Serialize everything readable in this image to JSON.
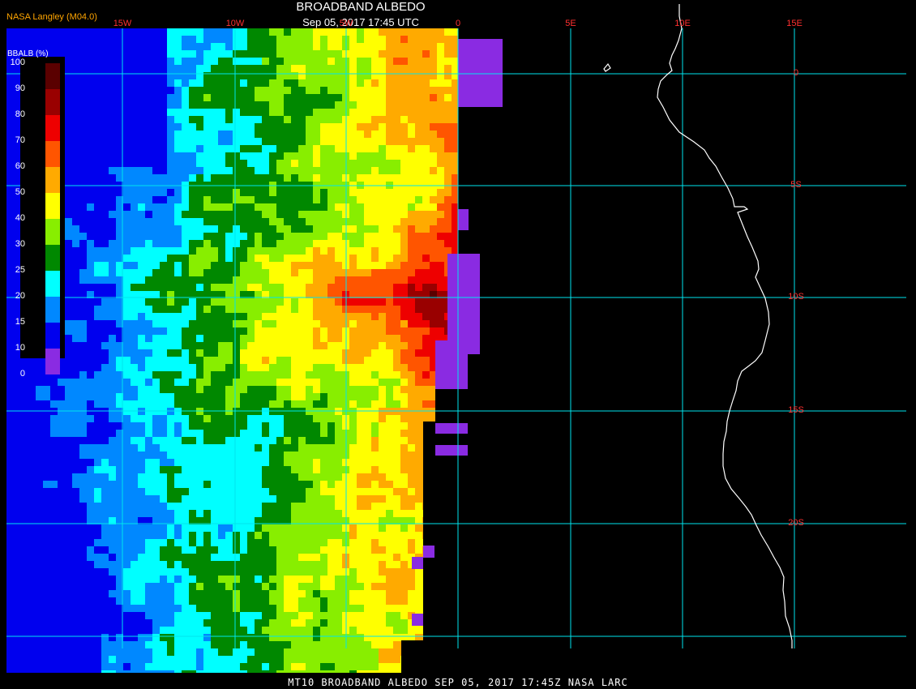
{
  "header": {
    "title": "BROADBAND ALBEDO",
    "datetime": "Sep 05, 2017 17:45 UTC",
    "credit": "NASA Langley (M04.0)",
    "credit_color": "#ffa500"
  },
  "footer": {
    "text": "MT10  BROADBAND ALBEDO   SEP 05, 2017 17:45Z   NASA LARC"
  },
  "legend": {
    "title": "BBALB (%)",
    "entries": [
      {
        "label": "100",
        "color": "#5a0000"
      },
      {
        "label": "90",
        "color": "#990000"
      },
      {
        "label": "80",
        "color": "#ee0000"
      },
      {
        "label": "70",
        "color": "#ff5500"
      },
      {
        "label": "60",
        "color": "#ffaa00"
      },
      {
        "label": "50",
        "color": "#ffff00"
      },
      {
        "label": "40",
        "color": "#88ee00"
      },
      {
        "label": "30",
        "color": "#008800"
      },
      {
        "label": "25",
        "color": "#00ffff"
      },
      {
        "label": "20",
        "color": "#0088ff"
      },
      {
        "label": "15",
        "color": "#0000ee"
      },
      {
        "label": "10",
        "color": "#8a2be2"
      },
      {
        "label": "0",
        "color": ""
      }
    ]
  },
  "grid": {
    "line_color": "#00e5ee",
    "label_color": "#ff3030",
    "lon_labels": [
      "15W",
      "10W",
      "5W",
      "0",
      "5E",
      "10E",
      "15E"
    ],
    "lat_labels": [
      "0",
      "5S",
      "10S",
      "15S",
      "20S"
    ]
  },
  "colors": {
    "coastline": "#ffffff",
    "missing_data": "#8a2be2",
    "background": "#000000"
  }
}
